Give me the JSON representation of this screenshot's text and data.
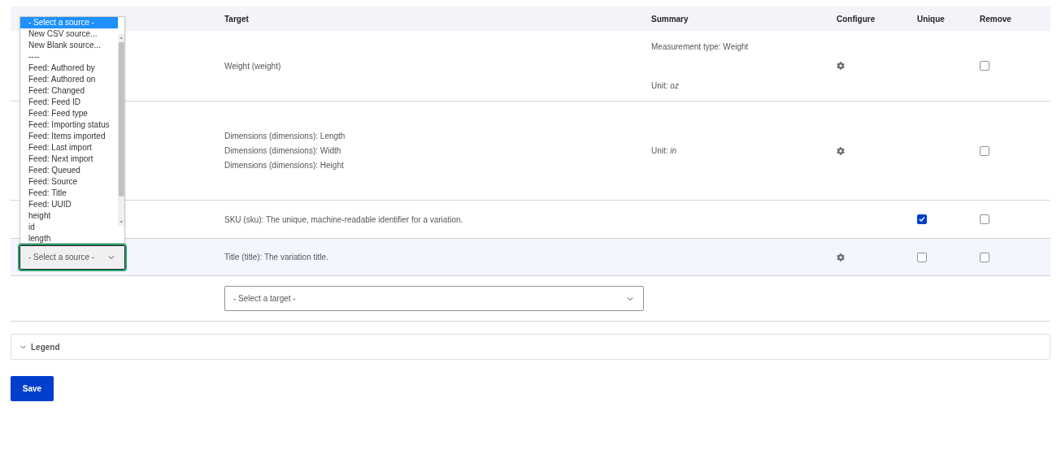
{
  "table": {
    "columns": [
      "Target",
      "Summary",
      "Configure",
      "Unique",
      "Remove"
    ],
    "rows": [
      {
        "target": [
          "Weight (weight)"
        ],
        "summary": [
          "Measurement type: Weight",
          "Unit: *oz*"
        ],
        "configure": true,
        "remove": false,
        "selected": false
      },
      {
        "target": [
          "Dimensions (dimensions): Length",
          "Dimensions (dimensions): Width",
          "Dimensions (dimensions): Height"
        ],
        "summary": [
          "Unit: *in*"
        ],
        "configure": true,
        "remove": false,
        "selected": false
      },
      {
        "target": [
          "SKU (sku): The unique, machine-readable identifier for a variation."
        ],
        "summary": [],
        "configure": false,
        "unique": true,
        "remove": false,
        "selected": false
      },
      {
        "source_select": {
          "value": "- Select a source -",
          "focused": true
        },
        "target": [
          "Title (title): The variation title."
        ],
        "summary": [],
        "configure": true,
        "unique": false,
        "remove": false,
        "selected": true
      }
    ],
    "new_target_select": {
      "value": "- Select a target -"
    }
  },
  "source_dropdown": {
    "options": [
      {
        "label": "- Select a source -",
        "selected": true
      },
      {
        "label": "New CSV source...",
        "selected": false
      },
      {
        "label": "New Blank source...",
        "selected": false
      },
      {
        "label": "----",
        "selected": false
      },
      {
        "label": "Feed: Authored by",
        "selected": false
      },
      {
        "label": "Feed: Authored on",
        "selected": false
      },
      {
        "label": "Feed: Changed",
        "selected": false
      },
      {
        "label": "Feed: Feed ID",
        "selected": false
      },
      {
        "label": "Feed: Feed type",
        "selected": false
      },
      {
        "label": "Feed: Importing status",
        "selected": false
      },
      {
        "label": "Feed: Items imported",
        "selected": false
      },
      {
        "label": "Feed: Last import",
        "selected": false
      },
      {
        "label": "Feed: Next import",
        "selected": false
      },
      {
        "label": "Feed: Queued",
        "selected": false
      },
      {
        "label": "Feed: Source",
        "selected": false
      },
      {
        "label": "Feed: Title",
        "selected": false
      },
      {
        "label": "Feed: UUID",
        "selected": false
      },
      {
        "label": "height",
        "selected": false
      },
      {
        "label": "id",
        "selected": false
      },
      {
        "label": "length",
        "selected": false
      }
    ]
  },
  "legend": {
    "label": "Legend",
    "expanded": false
  },
  "save_button": "Save"
}
